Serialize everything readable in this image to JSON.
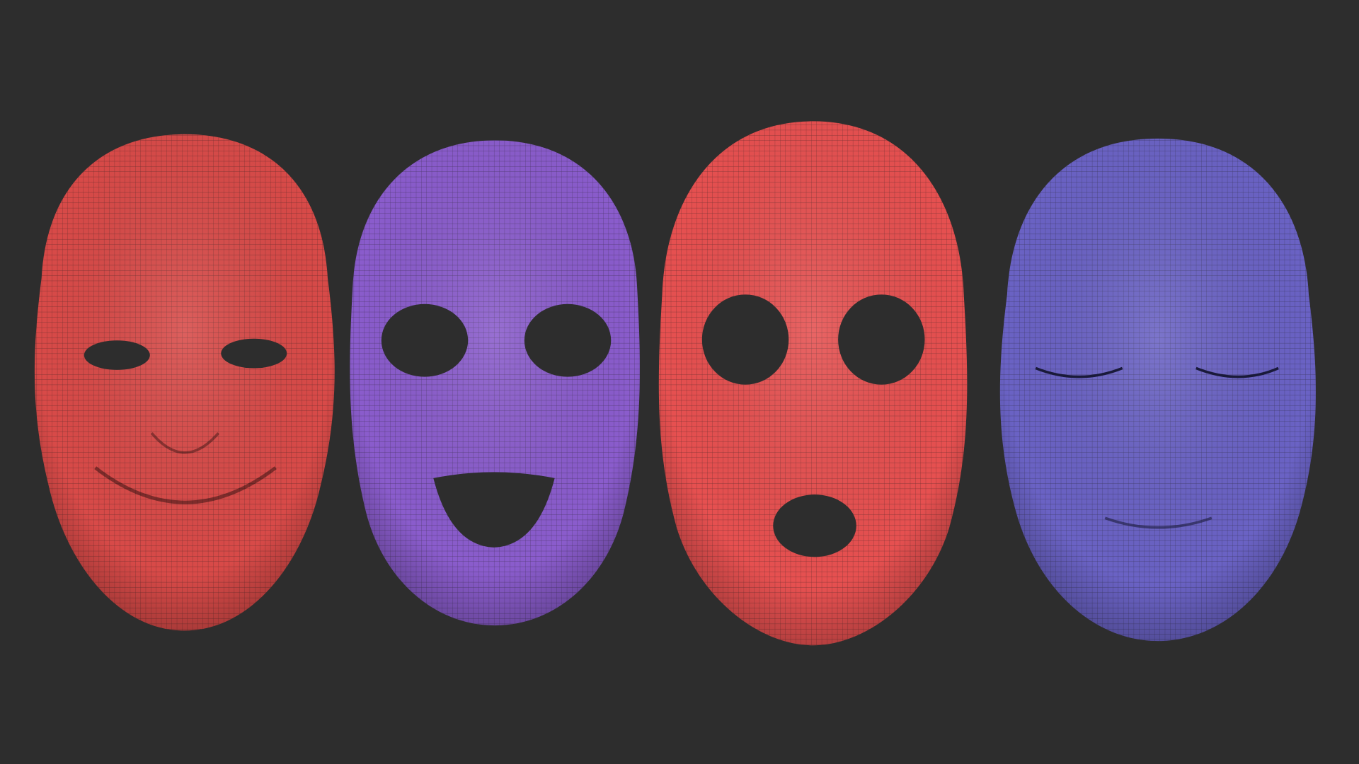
{
  "scene": {
    "background_color": "#2d2d2d",
    "masks": [
      {
        "expression": "smiling",
        "color": "#d84a48"
      },
      {
        "expression": "laughing",
        "color": "#8a5ccc"
      },
      {
        "expression": "surprised",
        "color": "#e65050"
      },
      {
        "expression": "serene-eyes-closed",
        "color": "#6a62c4"
      }
    ],
    "hole_color": "#2d2d2d",
    "wire_color": "#1a1a1a"
  }
}
